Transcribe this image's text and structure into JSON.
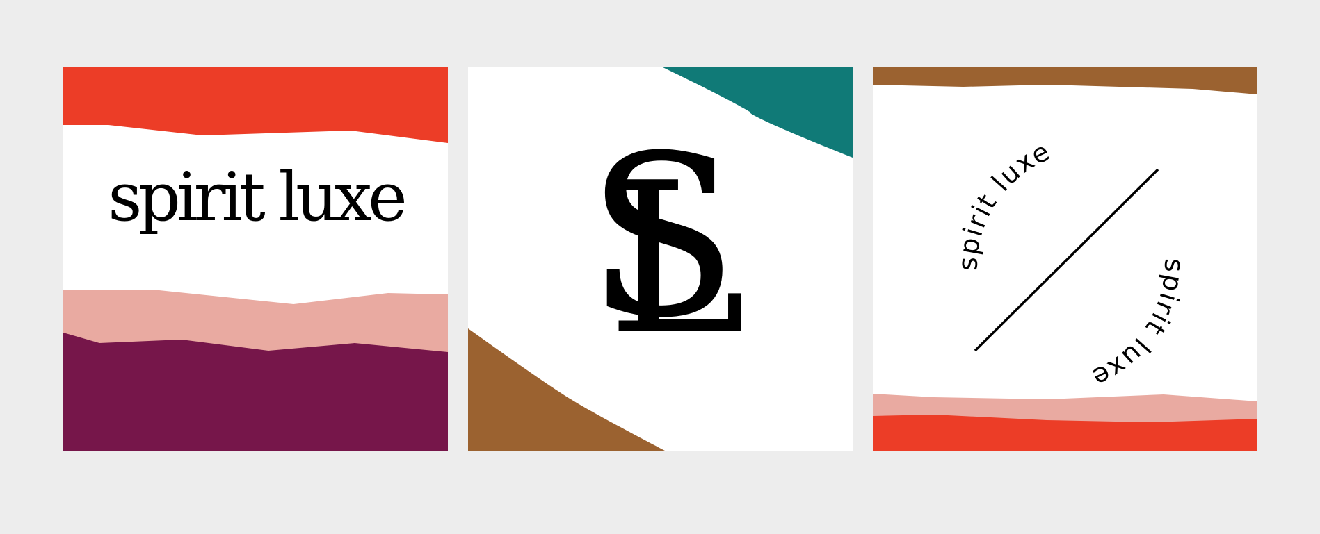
{
  "panels": [
    {
      "wordmark": "spirit luxe",
      "colors": {
        "top": "#ec3d27",
        "pink": "#e9aaa1",
        "plum": "#76164a"
      }
    },
    {
      "monogram_s": "S",
      "monogram_l": "L",
      "colors": {
        "teal": "#107a77",
        "brown": "#9b6230"
      }
    },
    {
      "arc_text_top": "spirit luxe",
      "arc_text_bottom": "spirit luxe",
      "colors": {
        "brown": "#9b6230",
        "pink": "#e9aaa1",
        "red": "#ec3d27"
      }
    }
  ]
}
